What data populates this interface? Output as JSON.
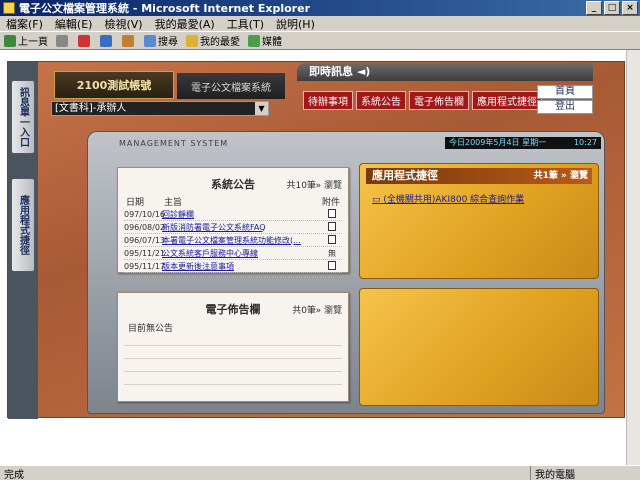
{
  "window": {
    "title": "電子公文檔案管理系統 - Microsoft Internet Explorer"
  },
  "menu": [
    "檔案(F)",
    "編輯(E)",
    "檢視(V)",
    "我的最愛(A)",
    "工具(T)",
    "說明(H)"
  ],
  "toolbar": {
    "back": "上一頁",
    "search": "搜尋",
    "favorites": "我的最愛",
    "media": "媒體"
  },
  "header": {
    "account_tab": "2100測試帳號",
    "system_tab": "電子公文檔案系統",
    "role_select": "[文書科]-承辦人",
    "instant_msg": "即時訊息",
    "buttons": [
      "待辦事項",
      "系統公告",
      "電子佈告欄",
      "應用程式捷徑"
    ],
    "home": "首頁",
    "logout": "登出"
  },
  "sidebar": {
    "tab1": "訊息單一入口",
    "tab2": "應用程式捷徑"
  },
  "panel": {
    "brand": "MANAGEMENT SYSTEM",
    "date": "今日2009年5月4日 星期一",
    "time": "10:27"
  },
  "announcements": {
    "title": "系統公告",
    "count": "共10筆",
    "browse": "瀏覽",
    "col_date": "日期",
    "col_subject": "主旨",
    "col_attach": "附件",
    "rows": [
      {
        "date": "097/10/16",
        "subject": "回診靜欄",
        "attach": "doc"
      },
      {
        "date": "096/08/02",
        "subject": "新版消防署電子公文系統FAQ",
        "attach": "doc"
      },
      {
        "date": "096/07/13",
        "subject": "本署電子公文檔案管理系統功能修改(...",
        "attach": "doc"
      },
      {
        "date": "095/11/21",
        "subject": "公文系統客戶服務中心專線",
        "attach": "無"
      },
      {
        "date": "095/11/17",
        "subject": "版本更新後注意事項",
        "attach": "doc"
      }
    ]
  },
  "bulletin": {
    "title": "電子佈告欄",
    "count": "共0筆",
    "browse": "瀏覽",
    "empty": "目前無公告"
  },
  "apps": {
    "title": "應用程式捷徑",
    "count": "共1筆",
    "browse": "瀏覽",
    "link": "(全機關共用)AKI800 綜合查詢作業"
  },
  "status": {
    "left": "完成",
    "right": "我的電腦"
  }
}
